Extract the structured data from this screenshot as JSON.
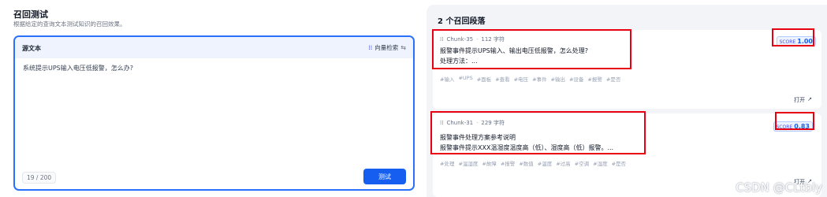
{
  "left": {
    "title": "召回测试",
    "subtitle": "根据给定的查询文本测试知识的召回效果。",
    "source_label": "源文本",
    "method_label": "向量检索",
    "method_icon": "grid-dots-icon",
    "toggle_icon": "swap-icon",
    "query": "系统提示UPS输入电压低报警，怎么办?",
    "counter": "19 / 200",
    "test_button": "测试"
  },
  "right": {
    "title": "2 个召回段落",
    "results": [
      {
        "chunk": "Chunk-35",
        "chars": "112 字符",
        "line1": "报警事件提示UPS输入、输出电压低报警，怎么处理?",
        "line2": "处理方法：...",
        "tags": [
          "#输入",
          "#UPS",
          "#面板",
          "#查看",
          "#电压",
          "#事件",
          "#输出",
          "#设备",
          "#报警",
          "#是否"
        ],
        "score_label": "SCORE",
        "score_value": "1.00",
        "open_label": "打开"
      },
      {
        "chunk": "Chunk-31",
        "chars": "229 字符",
        "line1": "报警事件处理方案参考说明",
        "line2": "报警事件提示XXX温湿度温度高（低）、湿度高（低）报警。...",
        "tags": [
          "#处理",
          "#温湿度",
          "#故障",
          "#报警",
          "#数值",
          "#温度",
          "#过高",
          "#空调",
          "#湿度",
          "#是否"
        ],
        "score_label": "SCORE",
        "score_value": "0.83",
        "open_label": "打开"
      }
    ]
  },
  "watermark": "CSDN @CLtbly",
  "colors": {
    "accent": "#155eef",
    "annotation": "#e60012",
    "panel_bg": "#f2f4f7"
  }
}
